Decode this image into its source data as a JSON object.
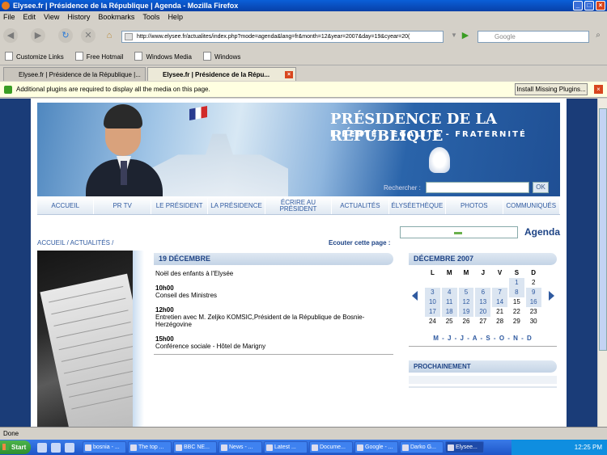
{
  "window": {
    "title": "Elysee.fr | Présidence de la République | Agenda - Mozilla Firefox"
  },
  "menu": [
    "File",
    "Edit",
    "View",
    "History",
    "Bookmarks",
    "Tools",
    "Help"
  ],
  "nav": {
    "url": "http://www.elysee.fr/actualites/index.php?mode=agenda&lang=fr&month=12&year=2007&day=19&cyear=20(",
    "search_placeholder": "Google"
  },
  "bookmarks": [
    "Customize Links",
    "Free Hotmail",
    "Windows Media",
    "Windows"
  ],
  "tabs": [
    "Elysee.fr | Présidence de la République |...",
    "Elysee.fr | Présidence de la Répu..."
  ],
  "notification": {
    "text": "Additional plugins are required to display all the media on this page.",
    "button": "Install Missing Plugins..."
  },
  "site": {
    "title": "PRÉSIDENCE DE LA RÉPUBLIQUE",
    "subtitle": "LIBERTÉ - EGALITÉ - FRATERNITÉ",
    "search_label": "Rechercher :",
    "search_button": "OK",
    "nav": [
      {
        "label": "ACCUEIL"
      },
      {
        "label": "PR TV"
      },
      {
        "label": "LE PRÉSIDENT"
      },
      {
        "label": "LA PRÉSIDENCE"
      },
      {
        "label": "ÉCRIRE AU PRÉSIDENT"
      },
      {
        "label": "ACTUALITÉS"
      },
      {
        "label": "ÉLYSÉETHÈQUE"
      },
      {
        "label": "PHOTOS"
      },
      {
        "label": "COMMUNIQUÉS"
      }
    ],
    "breadcrumb": "ACCUEIL / ACTUALITÉS /",
    "listen_label": "Ecouter cette page :",
    "section_title": "Agenda"
  },
  "agenda": {
    "day_heading": "19 DÉCEMBRE",
    "events": [
      {
        "time": "",
        "text": "Noël des enfants à l'Elysée"
      },
      {
        "time": "10h00",
        "text": "Conseil des Ministres"
      },
      {
        "time": "12h00",
        "text": "Entretien avec M. Zeljko KOMSIC,Président de la République de Bosnie-Herzégovine"
      },
      {
        "time": "15h00",
        "text": "Conférence sociale - Hôtel de Marigny"
      }
    ]
  },
  "calendar": {
    "heading": "DÉCEMBRE 2007",
    "weekdays": [
      "L",
      "M",
      "M",
      "J",
      "V",
      "S",
      "D"
    ],
    "weeks": [
      [
        "",
        "",
        "",
        "",
        "",
        "1",
        "2"
      ],
      [
        "3",
        "4",
        "5",
        "6",
        "7",
        "8",
        "9"
      ],
      [
        "10",
        "11",
        "12",
        "13",
        "14",
        "15",
        "16"
      ],
      [
        "17",
        "18",
        "19",
        "20",
        "21",
        "22",
        "23"
      ],
      [
        "24",
        "25",
        "26",
        "27",
        "28",
        "29",
        "30"
      ]
    ],
    "linked_days": [
      "1",
      "3",
      "4",
      "5",
      "6",
      "7",
      "8",
      "9",
      "10",
      "11",
      "12",
      "13",
      "14",
      "16",
      "17",
      "18",
      "19",
      "20"
    ],
    "months_nav": "M - J - J - A - S - O - N - D"
  },
  "upcoming": {
    "heading": "PROCHAINEMENT"
  },
  "status": "Done",
  "taskbar": {
    "start": "Start",
    "items": [
      "bosnia - ...",
      "The top ...",
      "BBC NE...",
      "News - ...",
      "Latest ...",
      "Docume...",
      "Google - ...",
      "Darko G...",
      "Elysee..."
    ],
    "clock": "12:25 PM"
  }
}
